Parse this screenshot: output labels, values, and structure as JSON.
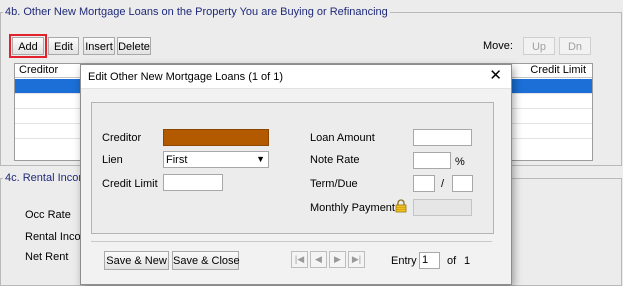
{
  "section_4b": {
    "title": "4b. Other New Mortgage Loans on the Property You are Buying or Refinancing",
    "add_label": "Add",
    "edit_label": "Edit",
    "insert_label": "Insert",
    "delete_label": "Delete",
    "move_label": "Move:",
    "up_label": "Up",
    "dn_label": "Dn",
    "columns": {
      "creditor": "Creditor",
      "credit_limit": "Credit Limit"
    }
  },
  "section_4c": {
    "title": "4c. Rental Incom",
    "labels": {
      "occ_rate": "Occ Rate",
      "rental_income": "Rental Incom",
      "net_rent": "Net Rent"
    }
  },
  "dialog": {
    "title": "Edit Other New Mortgage Loans (1 of 1)",
    "close_glyph": "✕",
    "labels": {
      "creditor": "Creditor",
      "lien": "Lien",
      "credit_limit": "Credit Limit",
      "loan_amount": "Loan Amount",
      "note_rate": "Note Rate",
      "percent": "%",
      "term_due": "Term/Due",
      "slash": "/",
      "monthly_payment": "Monthly Payment"
    },
    "values": {
      "creditor": "",
      "lien": "First",
      "credit_limit": "",
      "loan_amount": "",
      "note_rate": "",
      "term": "",
      "due": "",
      "monthly_payment": ""
    },
    "save_new_label": "Save & New",
    "save_close_label": "Save & Close",
    "entry_label": "Entry",
    "entry_value": "1",
    "of_label": "of",
    "total_value": "1",
    "colors": {
      "creditor_fill": "#b35a00",
      "selected_row": "#1b6fd6",
      "highlight": "#e3222b"
    }
  }
}
